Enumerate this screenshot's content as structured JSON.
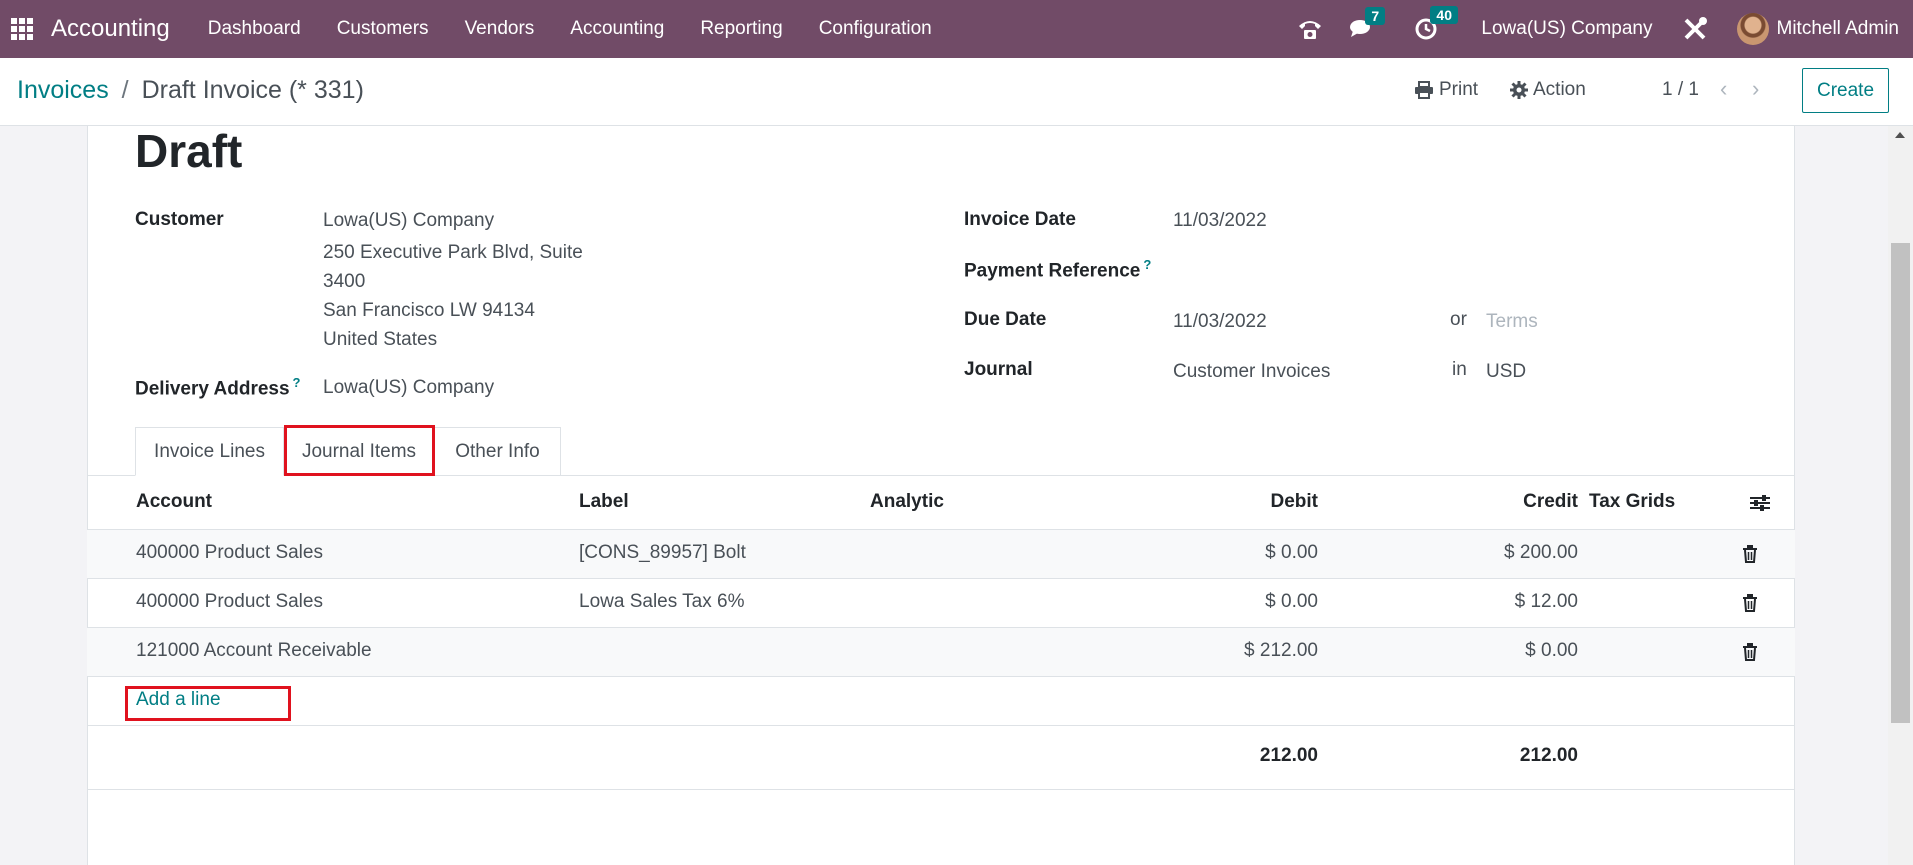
{
  "navbar": {
    "brand": "Accounting",
    "menu": [
      "Dashboard",
      "Customers",
      "Vendors",
      "Accounting",
      "Reporting",
      "Configuration"
    ],
    "messages_count": "7",
    "activities_count": "40",
    "company": "Lowa(US) Company",
    "user": "Mitchell Admin"
  },
  "control": {
    "breadcrumb_parent": "Invoices",
    "breadcrumb_sep": "/",
    "breadcrumb_current": "Draft Invoice (* 331)",
    "print_label": "Print",
    "action_label": "Action",
    "pager": "1 / 1",
    "create_label": "Create"
  },
  "invoice": {
    "title": "Draft",
    "customer_label": "Customer",
    "customer_name": "Lowa(US) Company",
    "customer_address_1": "250 Executive Park Blvd, Suite",
    "customer_address_2": "3400",
    "customer_address_3": "San Francisco LW 94134",
    "customer_address_4": "United States",
    "delivery_label": "Delivery Address",
    "delivery_value": "Lowa(US) Company",
    "invoice_date_label": "Invoice Date",
    "invoice_date": "11/03/2022",
    "payment_ref_label": "Payment Reference",
    "due_date_label": "Due Date",
    "due_date": "11/03/2022",
    "or_label": "or",
    "terms_placeholder": "Terms",
    "journal_label": "Journal",
    "journal_value": "Customer Invoices",
    "in_label": "in",
    "currency": "USD"
  },
  "tabs": [
    "Invoice Lines",
    "Journal Items",
    "Other Info"
  ],
  "table": {
    "headers": {
      "account": "Account",
      "label": "Label",
      "analytic": "Analytic",
      "debit": "Debit",
      "credit": "Credit",
      "tax_grids": "Tax Grids"
    },
    "rows": [
      {
        "account": "400000 Product Sales",
        "label": "[CONS_89957] Bolt",
        "debit": "$ 0.00",
        "credit": "$ 200.00"
      },
      {
        "account": "400000 Product Sales",
        "label": "Lowa Sales Tax 6%",
        "debit": "$ 0.00",
        "credit": "$ 12.00"
      },
      {
        "account": "121000 Account Receivable",
        "label": "",
        "debit": "$ 212.00",
        "credit": "$ 0.00"
      }
    ],
    "add_line": "Add a line",
    "total_debit": "212.00",
    "total_credit": "212.00"
  },
  "icons": {
    "apps": "apps-grid-icon",
    "phone": "phone-icon",
    "chat": "chat-icon",
    "clock": "clock-icon",
    "settings": "tools-icon",
    "print": "print-icon",
    "action": "gear-icon",
    "trash": "trash-icon",
    "column_settings": "sliders-icon"
  },
  "colors": {
    "navbar": "#714b67",
    "accent": "#017e84",
    "highlight": "#e0121e"
  }
}
